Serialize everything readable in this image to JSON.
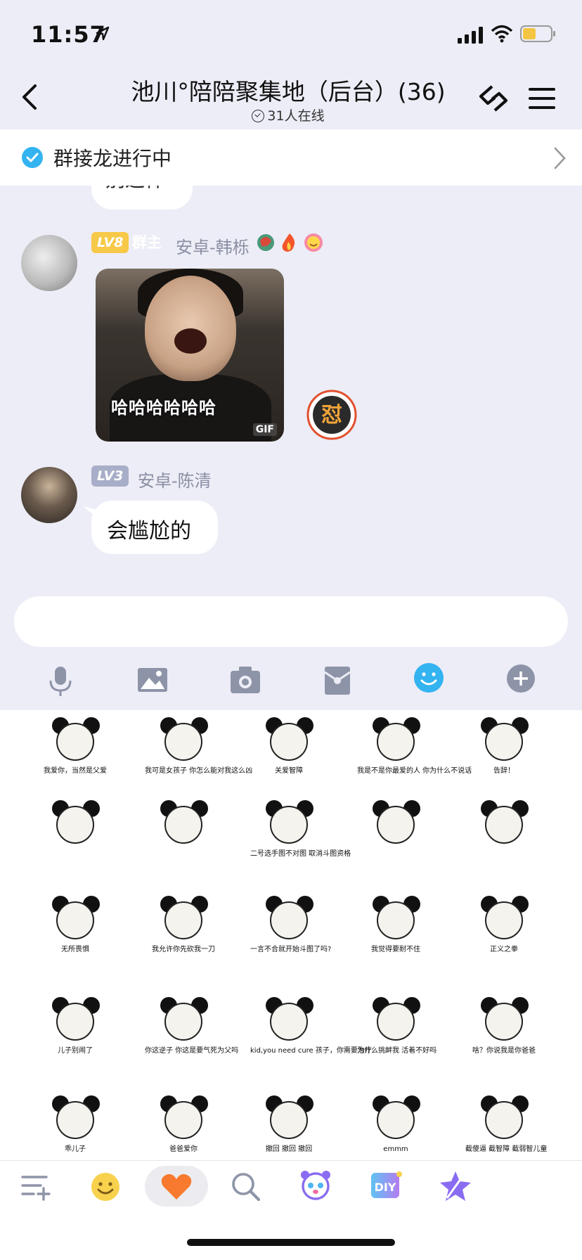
{
  "status": {
    "time": "11:57"
  },
  "header": {
    "title": "池川°陪陪聚集地（后台）(36)",
    "online": "31人在线"
  },
  "notice": {
    "text": "群接龙进行中"
  },
  "messages": [
    {
      "level": "LV8",
      "role": "群主",
      "sender": "安卓-韩栎",
      "badges": [
        "dragon-badge",
        "fire-badge",
        "smile-badge"
      ],
      "gif_caption": "哈哈哈哈哈哈",
      "gif_tag": "GIF",
      "reaction": "怼"
    },
    {
      "level": "LV3",
      "sender": "安卓-陈清",
      "text": "会尴尬的"
    }
  ],
  "previous_bubble_text": "别这样",
  "toolbar": [
    "microphone-icon",
    "image-icon",
    "camera-icon",
    "red-packet-icon",
    "emoji-icon",
    "plus-icon"
  ],
  "stickers": [
    [
      "我爱你，当然是父爱",
      "我可是女孩子 你怎么能对我这么凶",
      "关爱智障",
      "我是不是你最爱的人 你为什么不说话",
      "告辞！"
    ],
    [
      "",
      "",
      "二号选手图不对图 取消斗图资格",
      "",
      ""
    ],
    [
      "无所畏惧",
      "我允许你先砍我一刀",
      "一言不合就开始斗图了吗?",
      "我觉得要耐不住",
      "正义之拳"
    ],
    [
      "儿子别闹了",
      "你这逆子 你这是要气死为父吗",
      "kid,you need cure 孩子，你需要治疗",
      "为什么挑衅我 活着不好吗",
      "啥？你说我是你爸爸"
    ],
    [
      "乖儿子",
      "爸爸爱你",
      "撤回 撤回 撤回",
      "emmm",
      "截傻逼 截智障 截弱智儿童"
    ]
  ],
  "bottom_nav": [
    "list-add-icon",
    "emoji-face-icon",
    "heart-icon",
    "search-icon",
    "panda-icon",
    "diy-icon",
    "magic-icon"
  ],
  "colors": {
    "accent": "#33b3f0",
    "lv8": "#f7c948",
    "lv3": "#a8aec8",
    "bg": "#ededf7"
  }
}
